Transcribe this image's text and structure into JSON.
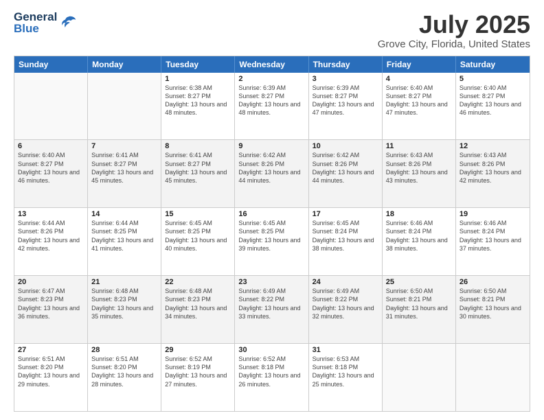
{
  "logo": {
    "general": "General",
    "blue": "Blue"
  },
  "title": "July 2025",
  "subtitle": "Grove City, Florida, United States",
  "days_of_week": [
    "Sunday",
    "Monday",
    "Tuesday",
    "Wednesday",
    "Thursday",
    "Friday",
    "Saturday"
  ],
  "weeks": [
    [
      {
        "day": "",
        "info": "",
        "empty": true
      },
      {
        "day": "",
        "info": "",
        "empty": true
      },
      {
        "day": "1",
        "sunrise": "6:38 AM",
        "sunset": "8:27 PM",
        "daylight": "13 hours and 48 minutes."
      },
      {
        "day": "2",
        "sunrise": "6:39 AM",
        "sunset": "8:27 PM",
        "daylight": "13 hours and 48 minutes."
      },
      {
        "day": "3",
        "sunrise": "6:39 AM",
        "sunset": "8:27 PM",
        "daylight": "13 hours and 47 minutes."
      },
      {
        "day": "4",
        "sunrise": "6:40 AM",
        "sunset": "8:27 PM",
        "daylight": "13 hours and 47 minutes."
      },
      {
        "day": "5",
        "sunrise": "6:40 AM",
        "sunset": "8:27 PM",
        "daylight": "13 hours and 46 minutes."
      }
    ],
    [
      {
        "day": "6",
        "sunrise": "6:40 AM",
        "sunset": "8:27 PM",
        "daylight": "13 hours and 46 minutes."
      },
      {
        "day": "7",
        "sunrise": "6:41 AM",
        "sunset": "8:27 PM",
        "daylight": "13 hours and 45 minutes."
      },
      {
        "day": "8",
        "sunrise": "6:41 AM",
        "sunset": "8:27 PM",
        "daylight": "13 hours and 45 minutes."
      },
      {
        "day": "9",
        "sunrise": "6:42 AM",
        "sunset": "8:26 PM",
        "daylight": "13 hours and 44 minutes."
      },
      {
        "day": "10",
        "sunrise": "6:42 AM",
        "sunset": "8:26 PM",
        "daylight": "13 hours and 44 minutes."
      },
      {
        "day": "11",
        "sunrise": "6:43 AM",
        "sunset": "8:26 PM",
        "daylight": "13 hours and 43 minutes."
      },
      {
        "day": "12",
        "sunrise": "6:43 AM",
        "sunset": "8:26 PM",
        "daylight": "13 hours and 42 minutes."
      }
    ],
    [
      {
        "day": "13",
        "sunrise": "6:44 AM",
        "sunset": "8:26 PM",
        "daylight": "13 hours and 42 minutes."
      },
      {
        "day": "14",
        "sunrise": "6:44 AM",
        "sunset": "8:25 PM",
        "daylight": "13 hours and 41 minutes."
      },
      {
        "day": "15",
        "sunrise": "6:45 AM",
        "sunset": "8:25 PM",
        "daylight": "13 hours and 40 minutes."
      },
      {
        "day": "16",
        "sunrise": "6:45 AM",
        "sunset": "8:25 PM",
        "daylight": "13 hours and 39 minutes."
      },
      {
        "day": "17",
        "sunrise": "6:45 AM",
        "sunset": "8:24 PM",
        "daylight": "13 hours and 38 minutes."
      },
      {
        "day": "18",
        "sunrise": "6:46 AM",
        "sunset": "8:24 PM",
        "daylight": "13 hours and 38 minutes."
      },
      {
        "day": "19",
        "sunrise": "6:46 AM",
        "sunset": "8:24 PM",
        "daylight": "13 hours and 37 minutes."
      }
    ],
    [
      {
        "day": "20",
        "sunrise": "6:47 AM",
        "sunset": "8:23 PM",
        "daylight": "13 hours and 36 minutes."
      },
      {
        "day": "21",
        "sunrise": "6:48 AM",
        "sunset": "8:23 PM",
        "daylight": "13 hours and 35 minutes."
      },
      {
        "day": "22",
        "sunrise": "6:48 AM",
        "sunset": "8:23 PM",
        "daylight": "13 hours and 34 minutes."
      },
      {
        "day": "23",
        "sunrise": "6:49 AM",
        "sunset": "8:22 PM",
        "daylight": "13 hours and 33 minutes."
      },
      {
        "day": "24",
        "sunrise": "6:49 AM",
        "sunset": "8:22 PM",
        "daylight": "13 hours and 32 minutes."
      },
      {
        "day": "25",
        "sunrise": "6:50 AM",
        "sunset": "8:21 PM",
        "daylight": "13 hours and 31 minutes."
      },
      {
        "day": "26",
        "sunrise": "6:50 AM",
        "sunset": "8:21 PM",
        "daylight": "13 hours and 30 minutes."
      }
    ],
    [
      {
        "day": "27",
        "sunrise": "6:51 AM",
        "sunset": "8:20 PM",
        "daylight": "13 hours and 29 minutes."
      },
      {
        "day": "28",
        "sunrise": "6:51 AM",
        "sunset": "8:20 PM",
        "daylight": "13 hours and 28 minutes."
      },
      {
        "day": "29",
        "sunrise": "6:52 AM",
        "sunset": "8:19 PM",
        "daylight": "13 hours and 27 minutes."
      },
      {
        "day": "30",
        "sunrise": "6:52 AM",
        "sunset": "8:18 PM",
        "daylight": "13 hours and 26 minutes."
      },
      {
        "day": "31",
        "sunrise": "6:53 AM",
        "sunset": "8:18 PM",
        "daylight": "13 hours and 25 minutes."
      },
      {
        "day": "",
        "info": "",
        "empty": true
      },
      {
        "day": "",
        "info": "",
        "empty": true
      }
    ]
  ]
}
